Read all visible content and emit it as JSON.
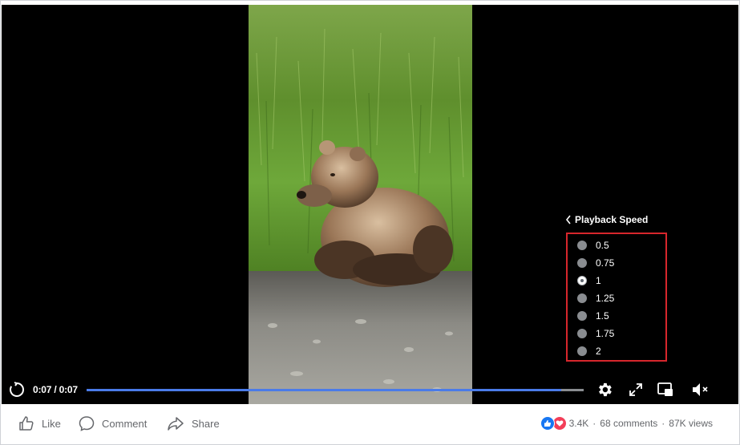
{
  "player": {
    "time_display": "0:07 / 0:07",
    "progress": 1.0,
    "speed_menu": {
      "title": "Playback Speed",
      "options": [
        "0.5",
        "0.75",
        "1",
        "1.25",
        "1.5",
        "1.75",
        "2"
      ],
      "selected": "1"
    },
    "icons": {
      "replay": "replay-icon",
      "settings": "gear-icon",
      "fullscreen": "expand-icon",
      "pip": "picture-in-picture-icon",
      "mute": "speaker-muted-icon"
    },
    "accent_color": "#4a7be8"
  },
  "actions": {
    "like_label": "Like",
    "comment_label": "Comment",
    "share_label": "Share"
  },
  "stats": {
    "reactions": "3.4K",
    "comments": "68 comments",
    "views": "87K views",
    "separator": "·"
  }
}
